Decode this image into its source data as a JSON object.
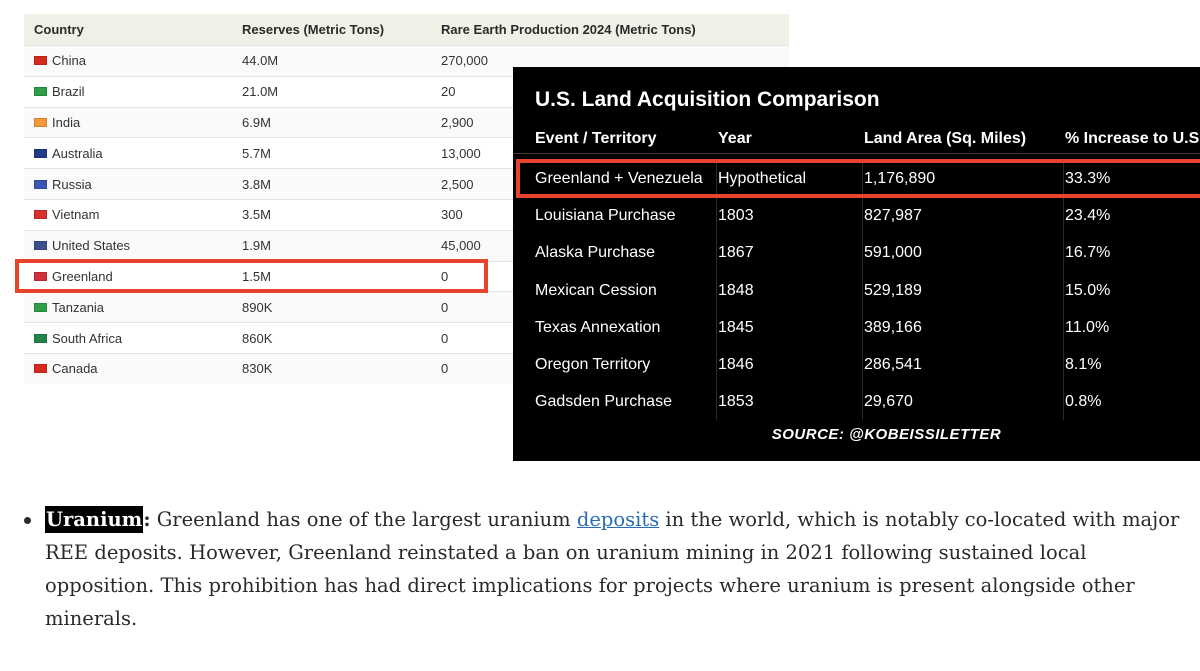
{
  "ree_table": {
    "headers": [
      "Country",
      "Reserves (Metric Tons)",
      "Rare Earth Production 2024 (Metric Tons)"
    ],
    "rows": [
      {
        "country": "China",
        "reserves": "44.0M",
        "production": "270,000",
        "flag_color": "#d52b1e"
      },
      {
        "country": "Brazil",
        "reserves": "21.0M",
        "production": "20",
        "flag_color": "#2e9e48"
      },
      {
        "country": "India",
        "reserves": "6.9M",
        "production": "2,900",
        "flag_color": "#f39a3c"
      },
      {
        "country": "Australia",
        "reserves": "5.7M",
        "production": "13,000",
        "flag_color": "#1f3b8a"
      },
      {
        "country": "Russia",
        "reserves": "3.8M",
        "production": "2,500",
        "flag_color": "#3a55b4"
      },
      {
        "country": "Vietnam",
        "reserves": "3.5M",
        "production": "300",
        "flag_color": "#d9302b"
      },
      {
        "country": "United States",
        "reserves": "1.9M",
        "production": "45,000",
        "flag_color": "#3c4f8c"
      },
      {
        "country": "Greenland",
        "reserves": "1.5M",
        "production": "0",
        "flag_color": "#d0313b"
      },
      {
        "country": "Tanzania",
        "reserves": "890K",
        "production": "0",
        "flag_color": "#2f9e46"
      },
      {
        "country": "South Africa",
        "reserves": "860K",
        "production": "0",
        "flag_color": "#23854a"
      },
      {
        "country": "Canada",
        "reserves": "830K",
        "production": "0",
        "flag_color": "#d52b1e"
      }
    ]
  },
  "land_table": {
    "title": "U.S. Land Acquisition Comparison",
    "headers": [
      "Event / Territory",
      "Year",
      "Land Area (Sq. Miles)",
      "% Increase to U.S"
    ],
    "rows": [
      {
        "event": "Greenland + Venezuela",
        "year": "Hypothetical",
        "area": "1,176,890",
        "increase": "33.3%"
      },
      {
        "event": "Louisiana Purchase",
        "year": "1803",
        "area": "827,987",
        "increase": "23.4%"
      },
      {
        "event": "Alaska Purchase",
        "year": "1867",
        "area": "591,000",
        "increase": "16.7%"
      },
      {
        "event": "Mexican Cession",
        "year": "1848",
        "area": "529,189",
        "increase": "15.0%"
      },
      {
        "event": "Texas Annexation",
        "year": "1845",
        "area": "389,166",
        "increase": "11.0%"
      },
      {
        "event": "Oregon Territory",
        "year": "1846",
        "area": "286,541",
        "increase": "8.1%"
      },
      {
        "event": "Gadsden Purchase",
        "year": "1853",
        "area": "29,670",
        "increase": "0.8%"
      }
    ],
    "source": "SOURCE: @KOBEISSILETTER"
  },
  "bullet": {
    "term": "Uranium",
    "colon": ":",
    "text_before_link": " Greenland has one of the largest uranium ",
    "link_text": "deposits",
    "text_after_link": " in the world, which is notably co-located with major REE deposits. However, Greenland reinstated a ban on uranium mining in 2021 following sustained local opposition. This prohibition has had direct implications for projects where uranium is present alongside other minerals."
  },
  "colors": {
    "highlight_border": "#e8432b",
    "header_bg": "#eef2e6",
    "link": "#2a6db5"
  }
}
